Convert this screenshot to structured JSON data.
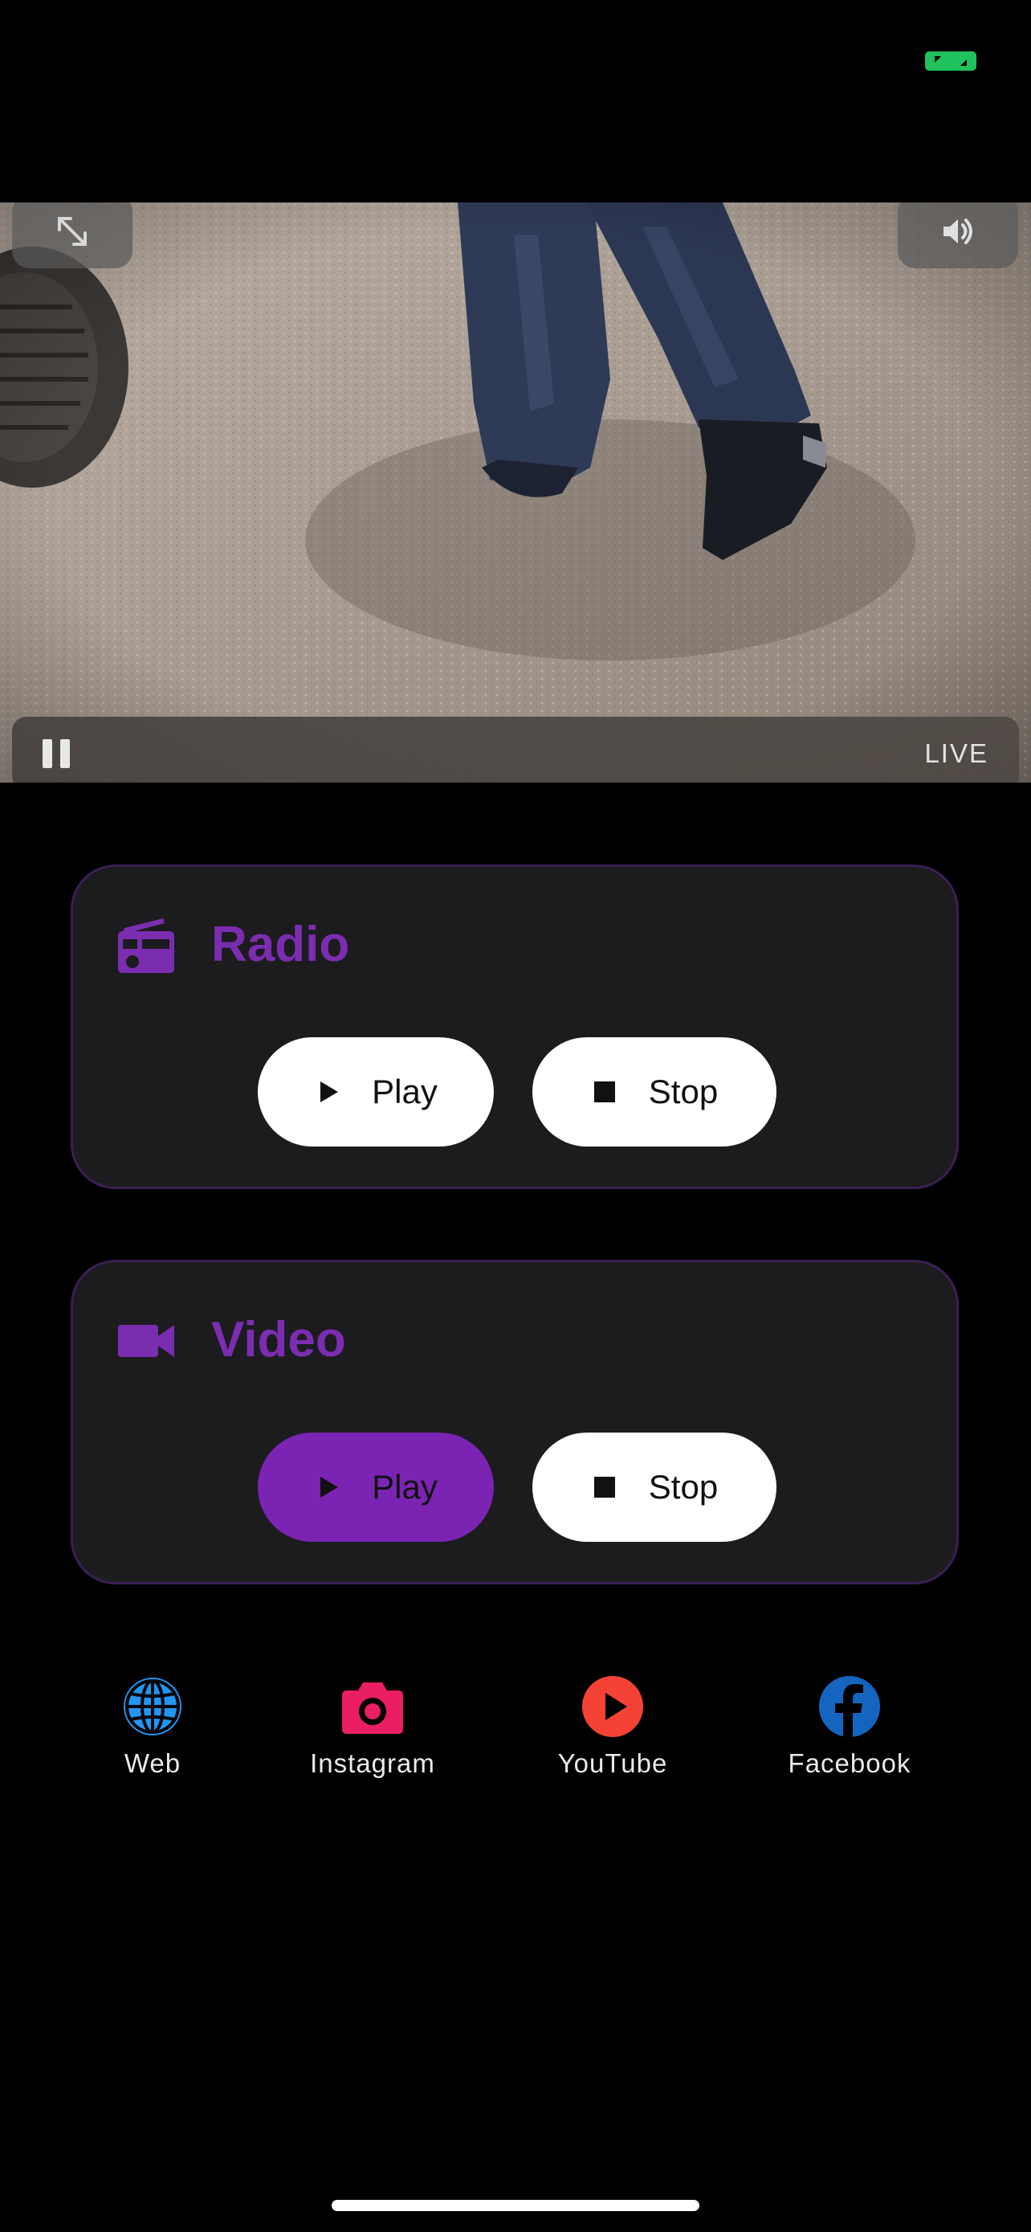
{
  "status": {
    "indicator_icon": "screen-share-icon",
    "indicator_color": "#1fc25c"
  },
  "video_player": {
    "fullscreen_icon": "expand-arrows-icon",
    "volume_icon": "speaker-icon",
    "pause_icon": "pause-icon",
    "live_label": "LIVE"
  },
  "radio": {
    "title": "Radio",
    "icon": "radio-icon",
    "play_label": "Play",
    "stop_label": "Stop"
  },
  "video": {
    "title": "Video",
    "icon": "videocam-icon",
    "play_label": "Play",
    "stop_label": "Stop",
    "play_active": true
  },
  "social": [
    {
      "label": "Web",
      "icon": "globe-icon",
      "color": "#2196f3"
    },
    {
      "label": "Instagram",
      "icon": "camera-icon",
      "color": "#e91e63"
    },
    {
      "label": "YouTube",
      "icon": "youtube-icon",
      "color": "#f44336"
    },
    {
      "label": "Facebook",
      "icon": "facebook-icon",
      "color": "#1565c0"
    }
  ],
  "colors": {
    "accent": "#7b2db0",
    "card_background": "#1c1b1e",
    "card_border": "#3a1f55",
    "background": "#000000"
  }
}
